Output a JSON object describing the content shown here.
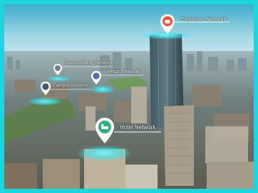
{
  "networks": [
    {
      "key": "employer",
      "label": "Employer Network",
      "icon": "briefcase-icon"
    },
    {
      "key": "transportation",
      "label": "Transportation Network",
      "icon": "car-icon"
    },
    {
      "key": "retail",
      "label": "Retail Network",
      "icon": "shopping-bag-icon"
    },
    {
      "key": "campus",
      "label": "Campus Network",
      "icon": "graduation-cap-icon"
    },
    {
      "key": "hotel",
      "label": "Hotel Network",
      "icon": "bed-icon"
    }
  ],
  "colors": {
    "frame": "#1dd6dd",
    "hotspot": "#36e3f0",
    "employer_pin": "#e8553f",
    "hotel_pin": "#2fae86",
    "transportation_pin": "#6d7f98",
    "retail_pin": "#4f6fa8",
    "campus_pin": "#42566d"
  }
}
